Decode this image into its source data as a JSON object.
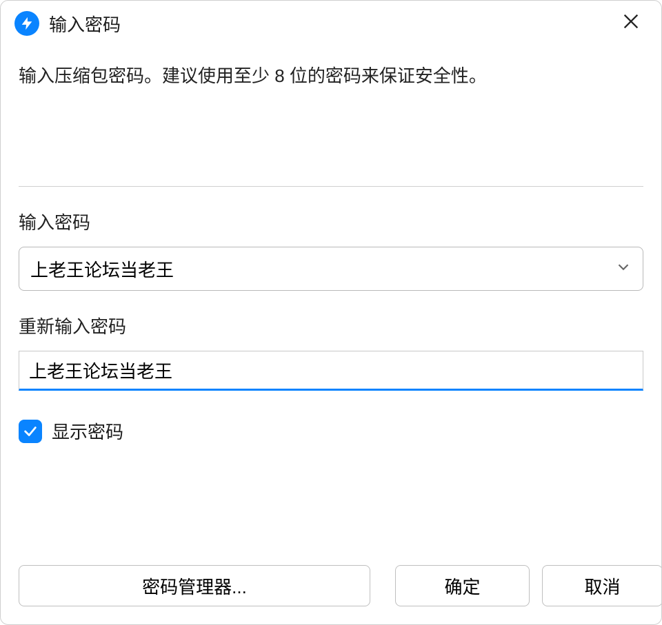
{
  "titlebar": {
    "title": "输入密码"
  },
  "instruction": "输入压缩包密码。建议使用至少 8 位的密码来保证安全性。",
  "passwordField": {
    "label": "输入密码",
    "value": "上老王论坛当老王"
  },
  "confirmField": {
    "label": "重新输入密码",
    "value": "上老王论坛当老王"
  },
  "showPassword": {
    "label": "显示密码",
    "checked": true
  },
  "buttons": {
    "passwordManager": "密码管理器...",
    "ok": "确定",
    "cancel": "取消"
  },
  "colors": {
    "accent": "#0a84ff"
  }
}
